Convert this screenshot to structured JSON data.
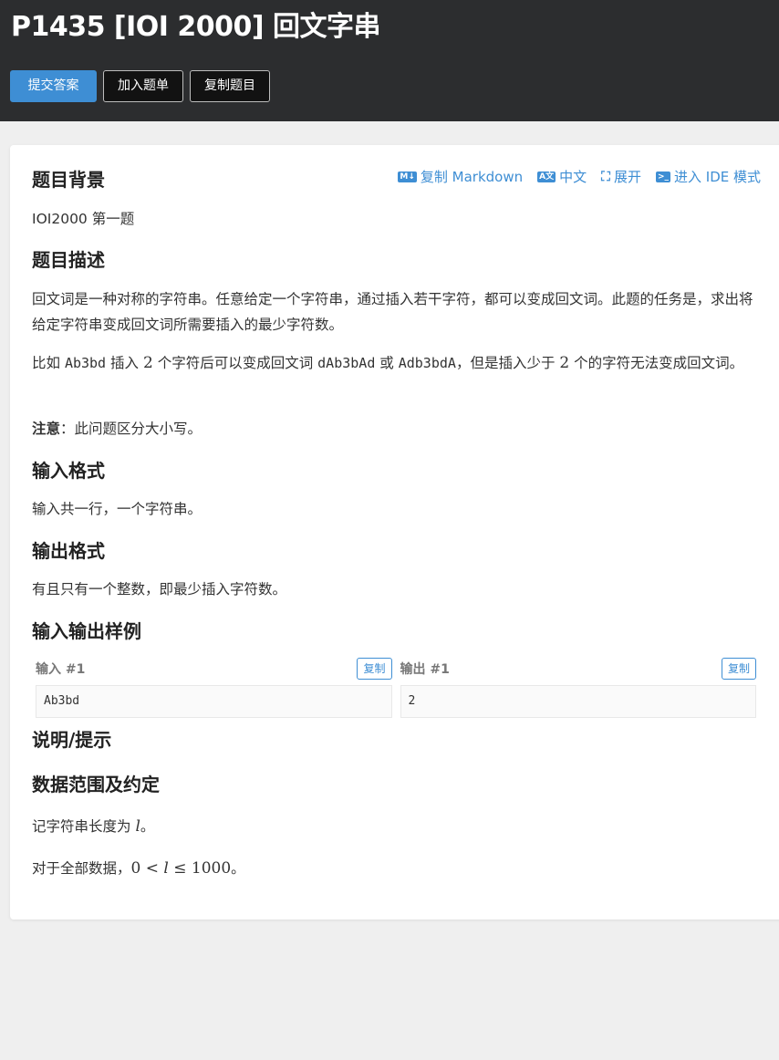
{
  "title": "P1435 [IOI 2000] 回文字串",
  "buttons": {
    "submit": "提交答案",
    "add_list": "加入题单",
    "copy_problem": "复制题目"
  },
  "toolbar": {
    "copy_markdown": "复制 Markdown",
    "language": "中文",
    "expand": "展开",
    "ide_mode": "进入 IDE 模式"
  },
  "sections": {
    "background_title": "题目背景",
    "background_text": "IOI2000 第一题",
    "description_title": "题目描述",
    "description_p1": "回文词是一种对称的字符串。任意给定一个字符串，通过插入若干字符，都可以变成回文词。此题的任务是，求出将给定字符串变成回文词所需要插入的最少字符数。",
    "example_prefix": "比如 ",
    "example_code1": "Ab3bd",
    "example_mid1": " 插入 ",
    "example_num1": "2",
    "example_mid2": " 个字符后可以变成回文词 ",
    "example_code2": "dAb3bAd",
    "example_or": " 或 ",
    "example_code3": "Adb3bdA",
    "example_mid3": "，但是插入少于 ",
    "example_num2": "2",
    "example_suffix": " 个的字符无法变成回文词。",
    "note_label": "注意",
    "note_text": "：此问题区分大小写。",
    "input_title": "输入格式",
    "input_text": "输入共一行，一个字符串。",
    "output_title": "输出格式",
    "output_text": "有且只有一个整数，即最少插入字符数。",
    "samples_title": "输入输出样例",
    "hint_title": "说明/提示",
    "range_title": "数据范围及约定",
    "range_p1_prefix": "记字符串长度为 ",
    "range_var": "l",
    "range_p1_suffix": "。",
    "range_p2_prefix": "对于全部数据，",
    "range_zero": "0",
    "range_lt": " < ",
    "range_var2": "l",
    "range_le": " ≤ ",
    "range_max": "1000",
    "range_p2_suffix": "。"
  },
  "samples": {
    "input_label": "输入 #1",
    "output_label": "输出 #1",
    "copy_label": "复制",
    "input_value": "Ab3bd",
    "output_value": "2"
  },
  "icons": {
    "markdown": "M↓",
    "lang": "A文",
    "ide": ">_"
  }
}
